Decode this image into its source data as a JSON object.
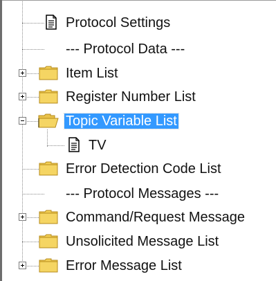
{
  "tree": {
    "items": [
      {
        "label": "Protocol Settings",
        "icon": "document-icon",
        "expander": "none",
        "selected": false
      },
      {
        "label": "--- Protocol Data ---",
        "icon": "none",
        "expander": "none",
        "selected": false
      },
      {
        "label": "Item List",
        "icon": "folder-icon",
        "expander": "plus",
        "selected": false
      },
      {
        "label": "Register Number List",
        "icon": "folder-icon",
        "expander": "plus",
        "selected": false
      },
      {
        "label": "Topic Variable List",
        "icon": "open-folder-icon",
        "expander": "minus",
        "selected": true
      },
      {
        "label": "TV",
        "icon": "document-icon",
        "expander": "none",
        "selected": false
      },
      {
        "label": "Error Detection Code List",
        "icon": "folder-icon",
        "expander": "none",
        "selected": false
      },
      {
        "label": "--- Protocol Messages ---",
        "icon": "none",
        "expander": "none",
        "selected": false
      },
      {
        "label": "Command/Request Message",
        "icon": "folder-icon",
        "expander": "plus",
        "selected": false
      },
      {
        "label": "Unsolicited Message List",
        "icon": "folder-icon",
        "expander": "none",
        "selected": false
      },
      {
        "label": "Error Message List",
        "icon": "folder-icon",
        "expander": "plus",
        "selected": false
      }
    ],
    "colors": {
      "selection": "#3399ff",
      "folder": "#f2cf55",
      "folder_edge": "#b58a1a",
      "tree_lines": "#8a8a8a"
    }
  }
}
